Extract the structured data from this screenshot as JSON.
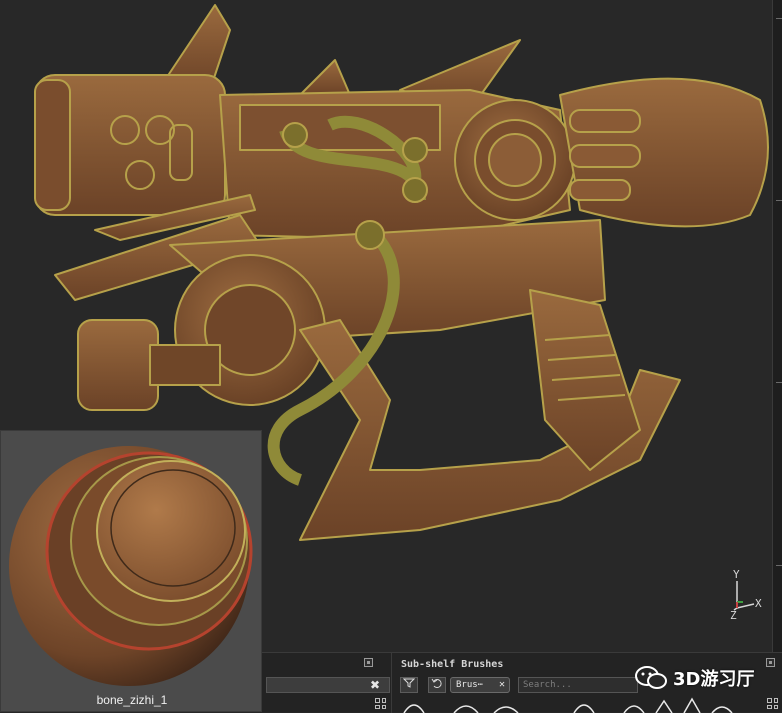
{
  "viewport": {
    "axis_labels": {
      "y": "Y",
      "x": "X",
      "z": "Z"
    }
  },
  "material_preview": {
    "name": "bone_zizhi_1"
  },
  "bottom_panel": {
    "close_symbol": "✖",
    "subshelf": {
      "title": "Sub-shelf Brushes",
      "filter_icon": "filter-icon",
      "undo_icon": "undo-icon",
      "brush_tab": "Brus⋯",
      "brush_tab_close": "✕",
      "search_placeholder": "Search..."
    }
  },
  "watermark": {
    "text": "3D游习厅",
    "icon": "wechat-icon"
  },
  "colors": {
    "viewport_bg": "#282828",
    "material_brown": "#8a5a35",
    "material_edge": "#b5a04a",
    "material_dark": "#5e3a22",
    "preview_bg": "#4b4b4b"
  }
}
